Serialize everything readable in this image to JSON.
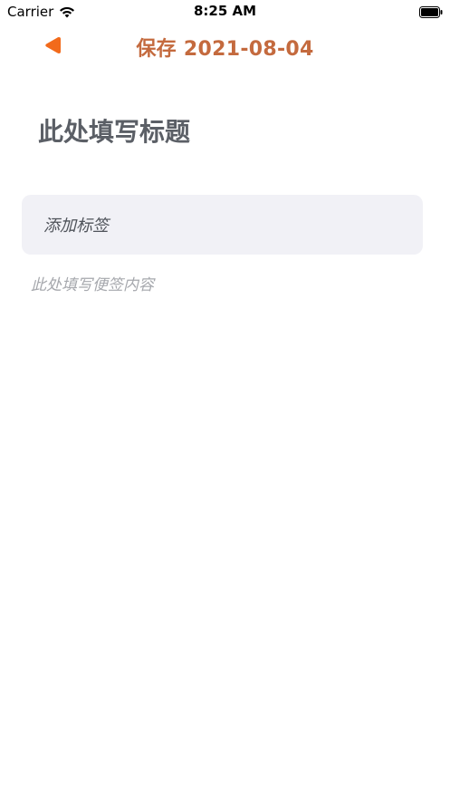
{
  "status_bar": {
    "carrier": "Carrier",
    "time": "8:25 AM",
    "wifi_icon": "wifi-icon",
    "battery_icon": "battery-icon"
  },
  "nav": {
    "back_icon": "back-triangle-icon",
    "title": "保存 2021-08-04",
    "accent_color": "#c46a3e",
    "back_color": "#f26a1b"
  },
  "note": {
    "title_placeholder": "此处填写标题",
    "tag_placeholder": "添加标签",
    "content_placeholder": "此处填写便签内容"
  },
  "colors": {
    "background": "#ffffff",
    "tag_field_bg": "#f1f1f6",
    "title_text": "#5b5f66",
    "placeholder_text": "#a6a8ad"
  }
}
